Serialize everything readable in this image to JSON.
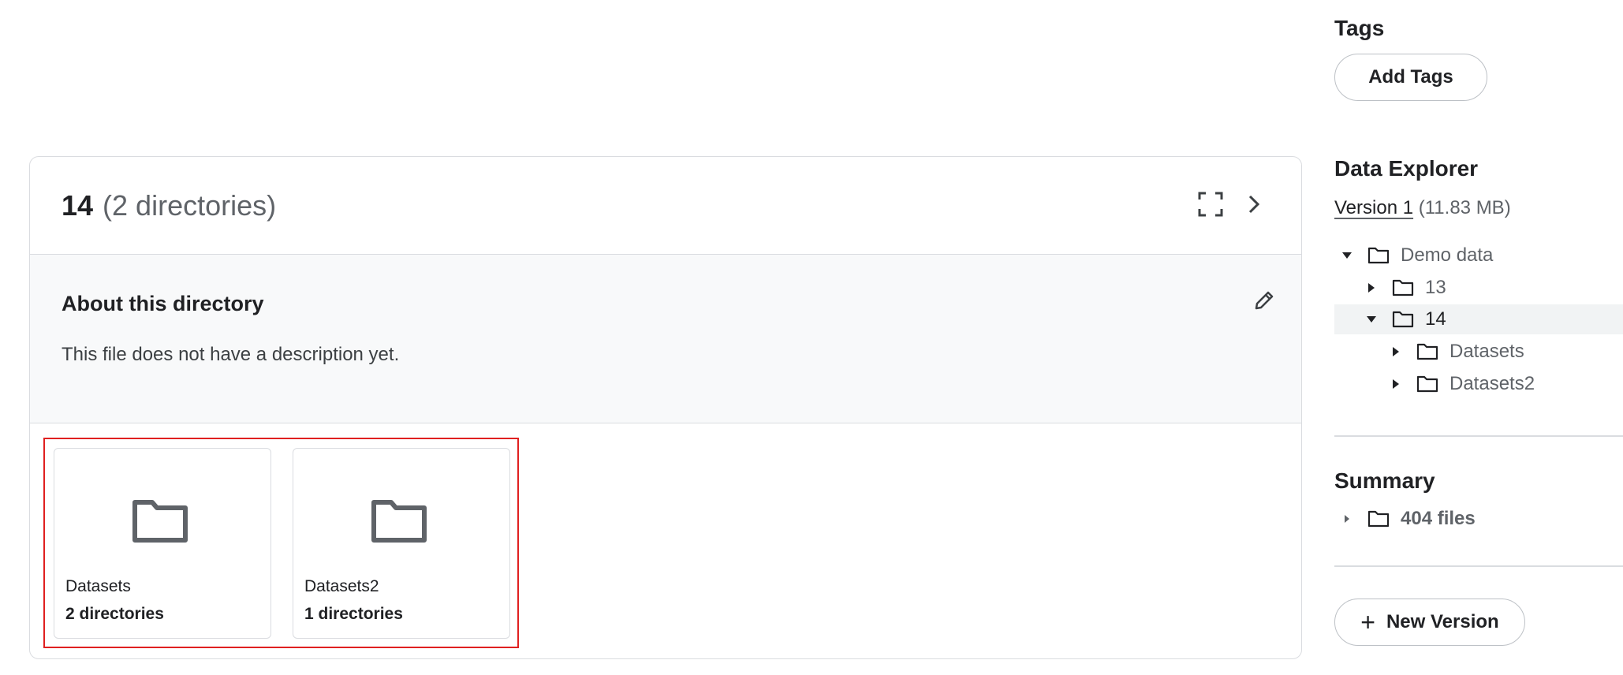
{
  "tags": {
    "heading": "Tags",
    "add_button": "Add Tags"
  },
  "card": {
    "title_number": "14",
    "title_sub": "(2 directories)",
    "about_title": "About this directory",
    "about_desc": "This file does not have a description yet.",
    "tiles": [
      {
        "name": "Datasets",
        "count": "2 directories"
      },
      {
        "name": "Datasets2",
        "count": "1 directories"
      }
    ]
  },
  "explorer": {
    "heading": "Data Explorer",
    "version_label": "Version 1",
    "version_size": "(11.83 MB)",
    "tree": [
      {
        "label": "Demo data",
        "expanded": true
      },
      {
        "label": "13",
        "expanded": false
      },
      {
        "label": "14",
        "expanded": true,
        "selected": true
      },
      {
        "label": "Datasets",
        "expanded": false
      },
      {
        "label": "Datasets2",
        "expanded": false
      }
    ]
  },
  "summary": {
    "heading": "Summary",
    "files": "404 files"
  },
  "new_version_button": "New Version",
  "colors": {
    "border": "#dadce0",
    "highlight_box": "#e02020",
    "panel_bg": "#f8f9fa",
    "selected_row": "#f1f3f4"
  }
}
